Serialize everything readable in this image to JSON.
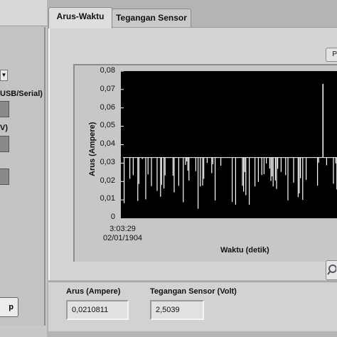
{
  "left_panel": {
    "label_usb": "USB/Serial)",
    "label_v": "V)",
    "stop_label": "p"
  },
  "tabs": [
    {
      "label": "Arus-Waktu",
      "active": true
    },
    {
      "label": "Tegangan Sensor",
      "active": false
    }
  ],
  "plot": {
    "ylabel": "Arus (Ampere)",
    "xlabel": "Waktu (detik)",
    "x_tick_time": "3:03:29",
    "x_tick_date": "02/01/1904",
    "y_ticks": [
      "0,08",
      "0,07",
      "0,06",
      "0,05",
      "0,04",
      "0,03",
      "0,02",
      "0,01",
      "0"
    ],
    "plot_button_partial": "P",
    "background": "#000000",
    "trace_color": "#ffffff"
  },
  "chart_data": {
    "type": "line",
    "xlabel": "Waktu (detik)",
    "ylabel": "Arus (Ampere)",
    "ylim": [
      0,
      0.08
    ],
    "x_start_label": "3:03:29 02/01/1904",
    "baseline": 0.033,
    "trace_min": 0.005,
    "trace_max": 0.033,
    "spike_peak": 0.073,
    "grid": false
  },
  "indicators": {
    "arus_label": "Arus (Ampere)",
    "arus_value": "0,0210811",
    "tegangan_label": "Tegangan Sensor (Volt)",
    "tegangan_value": "2,5039"
  }
}
